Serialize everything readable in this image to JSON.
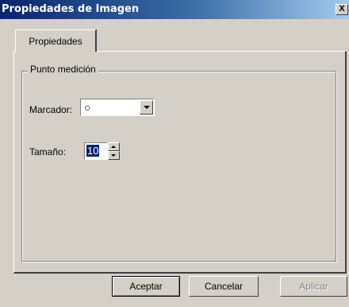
{
  "window": {
    "title": "Propiedades de Imagen",
    "close_label": "X"
  },
  "tabs": [
    {
      "label": "Propiedades",
      "selected": true
    }
  ],
  "group": {
    "label": "Punto medición",
    "marker": {
      "label": "Marcador:",
      "value": "○",
      "options_visible": [
        "○"
      ]
    },
    "size": {
      "label": "Tamaño:",
      "value": "10"
    }
  },
  "buttons": {
    "accept": "Aceptar",
    "cancel": "Cancelar",
    "apply": "Aplicar"
  },
  "icons": {
    "close": "close-icon",
    "dropdown": "chevron-down-icon",
    "spin_up": "arrow-up-icon",
    "spin_down": "arrow-down-icon"
  }
}
